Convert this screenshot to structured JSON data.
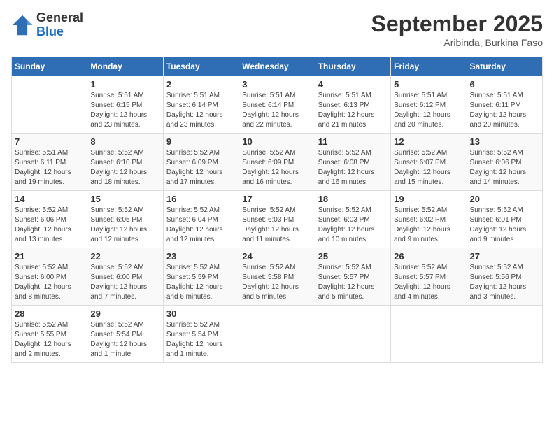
{
  "header": {
    "logo_general": "General",
    "logo_blue": "Blue",
    "month": "September 2025",
    "location": "Aribinda, Burkina Faso"
  },
  "weekdays": [
    "Sunday",
    "Monday",
    "Tuesday",
    "Wednesday",
    "Thursday",
    "Friday",
    "Saturday"
  ],
  "weeks": [
    [
      {
        "day": "",
        "info": ""
      },
      {
        "day": "1",
        "info": "Sunrise: 5:51 AM\nSunset: 6:15 PM\nDaylight: 12 hours\nand 23 minutes."
      },
      {
        "day": "2",
        "info": "Sunrise: 5:51 AM\nSunset: 6:14 PM\nDaylight: 12 hours\nand 23 minutes."
      },
      {
        "day": "3",
        "info": "Sunrise: 5:51 AM\nSunset: 6:14 PM\nDaylight: 12 hours\nand 22 minutes."
      },
      {
        "day": "4",
        "info": "Sunrise: 5:51 AM\nSunset: 6:13 PM\nDaylight: 12 hours\nand 21 minutes."
      },
      {
        "day": "5",
        "info": "Sunrise: 5:51 AM\nSunset: 6:12 PM\nDaylight: 12 hours\nand 20 minutes."
      },
      {
        "day": "6",
        "info": "Sunrise: 5:51 AM\nSunset: 6:11 PM\nDaylight: 12 hours\nand 20 minutes."
      }
    ],
    [
      {
        "day": "7",
        "info": "Sunrise: 5:51 AM\nSunset: 6:11 PM\nDaylight: 12 hours\nand 19 minutes."
      },
      {
        "day": "8",
        "info": "Sunrise: 5:52 AM\nSunset: 6:10 PM\nDaylight: 12 hours\nand 18 minutes."
      },
      {
        "day": "9",
        "info": "Sunrise: 5:52 AM\nSunset: 6:09 PM\nDaylight: 12 hours\nand 17 minutes."
      },
      {
        "day": "10",
        "info": "Sunrise: 5:52 AM\nSunset: 6:09 PM\nDaylight: 12 hours\nand 16 minutes."
      },
      {
        "day": "11",
        "info": "Sunrise: 5:52 AM\nSunset: 6:08 PM\nDaylight: 12 hours\nand 16 minutes."
      },
      {
        "day": "12",
        "info": "Sunrise: 5:52 AM\nSunset: 6:07 PM\nDaylight: 12 hours\nand 15 minutes."
      },
      {
        "day": "13",
        "info": "Sunrise: 5:52 AM\nSunset: 6:06 PM\nDaylight: 12 hours\nand 14 minutes."
      }
    ],
    [
      {
        "day": "14",
        "info": "Sunrise: 5:52 AM\nSunset: 6:06 PM\nDaylight: 12 hours\nand 13 minutes."
      },
      {
        "day": "15",
        "info": "Sunrise: 5:52 AM\nSunset: 6:05 PM\nDaylight: 12 hours\nand 12 minutes."
      },
      {
        "day": "16",
        "info": "Sunrise: 5:52 AM\nSunset: 6:04 PM\nDaylight: 12 hours\nand 12 minutes."
      },
      {
        "day": "17",
        "info": "Sunrise: 5:52 AM\nSunset: 6:03 PM\nDaylight: 12 hours\nand 11 minutes."
      },
      {
        "day": "18",
        "info": "Sunrise: 5:52 AM\nSunset: 6:03 PM\nDaylight: 12 hours\nand 10 minutes."
      },
      {
        "day": "19",
        "info": "Sunrise: 5:52 AM\nSunset: 6:02 PM\nDaylight: 12 hours\nand 9 minutes."
      },
      {
        "day": "20",
        "info": "Sunrise: 5:52 AM\nSunset: 6:01 PM\nDaylight: 12 hours\nand 9 minutes."
      }
    ],
    [
      {
        "day": "21",
        "info": "Sunrise: 5:52 AM\nSunset: 6:00 PM\nDaylight: 12 hours\nand 8 minutes."
      },
      {
        "day": "22",
        "info": "Sunrise: 5:52 AM\nSunset: 6:00 PM\nDaylight: 12 hours\nand 7 minutes."
      },
      {
        "day": "23",
        "info": "Sunrise: 5:52 AM\nSunset: 5:59 PM\nDaylight: 12 hours\nand 6 minutes."
      },
      {
        "day": "24",
        "info": "Sunrise: 5:52 AM\nSunset: 5:58 PM\nDaylight: 12 hours\nand 5 minutes."
      },
      {
        "day": "25",
        "info": "Sunrise: 5:52 AM\nSunset: 5:57 PM\nDaylight: 12 hours\nand 5 minutes."
      },
      {
        "day": "26",
        "info": "Sunrise: 5:52 AM\nSunset: 5:57 PM\nDaylight: 12 hours\nand 4 minutes."
      },
      {
        "day": "27",
        "info": "Sunrise: 5:52 AM\nSunset: 5:56 PM\nDaylight: 12 hours\nand 3 minutes."
      }
    ],
    [
      {
        "day": "28",
        "info": "Sunrise: 5:52 AM\nSunset: 5:55 PM\nDaylight: 12 hours\nand 2 minutes."
      },
      {
        "day": "29",
        "info": "Sunrise: 5:52 AM\nSunset: 5:54 PM\nDaylight: 12 hours\nand 1 minute."
      },
      {
        "day": "30",
        "info": "Sunrise: 5:52 AM\nSunset: 5:54 PM\nDaylight: 12 hours\nand 1 minute."
      },
      {
        "day": "",
        "info": ""
      },
      {
        "day": "",
        "info": ""
      },
      {
        "day": "",
        "info": ""
      },
      {
        "day": "",
        "info": ""
      }
    ]
  ]
}
